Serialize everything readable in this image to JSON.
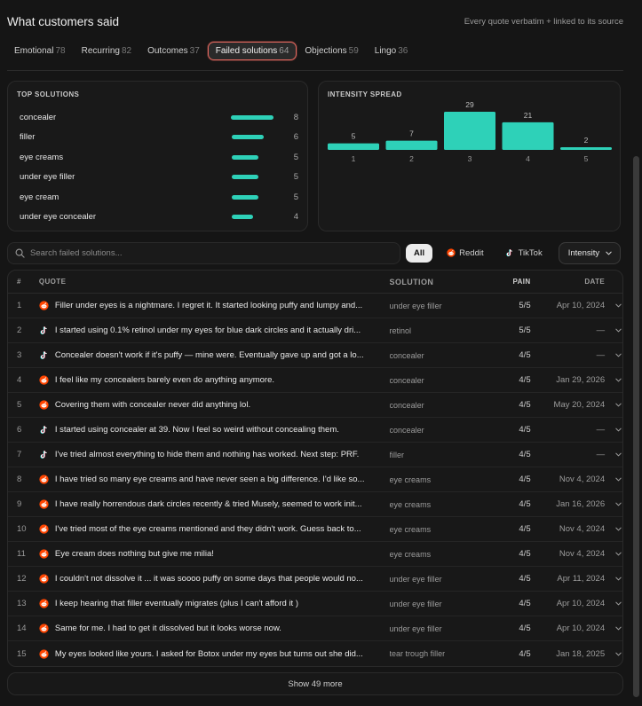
{
  "header": {
    "title": "What customers said",
    "subtitle": "Every quote verbatim + linked to its source"
  },
  "tabs": [
    {
      "label": "Emotional",
      "count": "78"
    },
    {
      "label": "Recurring",
      "count": "82"
    },
    {
      "label": "Outcomes",
      "count": "37"
    },
    {
      "label": "Failed solutions",
      "count": "64",
      "active": true
    },
    {
      "label": "Objections",
      "count": "59"
    },
    {
      "label": "Lingo",
      "count": "36"
    }
  ],
  "top_solutions": {
    "title": "TOP SOLUTIONS",
    "items": [
      {
        "name": "concealer",
        "count": 8
      },
      {
        "name": "filler",
        "count": 6
      },
      {
        "name": "eye creams",
        "count": 5
      },
      {
        "name": "under eye filler",
        "count": 5
      },
      {
        "name": "eye cream",
        "count": 5
      },
      {
        "name": "under eye concealer",
        "count": 4
      }
    ]
  },
  "chart_data": {
    "type": "bar",
    "title": "INTENSITY SPREAD",
    "categories": [
      "1",
      "2",
      "3",
      "4",
      "5"
    ],
    "values": [
      5,
      7,
      29,
      21,
      2
    ],
    "ylim": [
      0,
      29
    ],
    "grid": false,
    "color": "#2ed1b8"
  },
  "filters": {
    "search_placeholder": "Search failed solutions...",
    "chips": [
      {
        "label": "All",
        "active": true,
        "icon": ""
      },
      {
        "label": "Reddit",
        "active": false,
        "icon": "reddit-icon"
      },
      {
        "label": "TikTok",
        "active": false,
        "icon": "tiktok-icon"
      }
    ],
    "sort_label": "Intensity"
  },
  "table": {
    "columns": {
      "num": "#",
      "quote": "QUOTE",
      "solution": "SOLUTION",
      "pain": "PAIN",
      "date": "DATE"
    },
    "rows": [
      {
        "num": "1",
        "source": "reddit",
        "quote": "Filler under eyes is a nightmare. I regret it. It started looking puffy and lumpy and...",
        "solution": "under eye filler",
        "pain": "5/5",
        "date": "Apr 10, 2024"
      },
      {
        "num": "2",
        "source": "tiktok",
        "quote": "I started using 0.1% retinol under my eyes for blue dark circles and it actually dri...",
        "solution": "retinol",
        "pain": "5/5",
        "date": "—"
      },
      {
        "num": "3",
        "source": "tiktok",
        "quote": "Concealer doesn't work if it's puffy — mine were. Eventually gave up and got a lo...",
        "solution": "concealer",
        "pain": "4/5",
        "date": "—"
      },
      {
        "num": "4",
        "source": "reddit",
        "quote": "I feel like my concealers barely even do anything anymore.",
        "solution": "concealer",
        "pain": "4/5",
        "date": "Jan 29, 2026"
      },
      {
        "num": "5",
        "source": "reddit",
        "quote": "Covering them with concealer never did anything lol.",
        "solution": "concealer",
        "pain": "4/5",
        "date": "May 20, 2024"
      },
      {
        "num": "6",
        "source": "tiktok",
        "quote": "I started using concealer at 39. Now I feel so weird without concealing them.",
        "solution": "concealer",
        "pain": "4/5",
        "date": "—"
      },
      {
        "num": "7",
        "source": "tiktok",
        "quote": "I've tried almost everything to hide them and nothing has worked. Next step: PRF.",
        "solution": "filler",
        "pain": "4/5",
        "date": "—"
      },
      {
        "num": "8",
        "source": "reddit",
        "quote": "I have tried so many eye creams and have never seen a big difference. I'd like so...",
        "solution": "eye creams",
        "pain": "4/5",
        "date": "Nov 4, 2024"
      },
      {
        "num": "9",
        "source": "reddit",
        "quote": "I have really horrendous dark circles recently & tried Musely, seemed to work init...",
        "solution": "eye creams",
        "pain": "4/5",
        "date": "Jan 16, 2026"
      },
      {
        "num": "10",
        "source": "reddit",
        "quote": "I've tried most of the eye creams mentioned and they didn't work. Guess back to...",
        "solution": "eye creams",
        "pain": "4/5",
        "date": "Nov 4, 2024"
      },
      {
        "num": "11",
        "source": "reddit",
        "quote": "Eye cream does nothing but give me milia!",
        "solution": "eye creams",
        "pain": "4/5",
        "date": "Nov 4, 2024"
      },
      {
        "num": "12",
        "source": "reddit",
        "quote": "I couldn't not dissolve it ... it was soooo puffy on some days that people would no...",
        "solution": "under eye filler",
        "pain": "4/5",
        "date": "Apr 11, 2024"
      },
      {
        "num": "13",
        "source": "reddit",
        "quote": "I keep hearing that filler eventually migrates (plus I can't afford it )",
        "solution": "under eye filler",
        "pain": "4/5",
        "date": "Apr 10, 2024"
      },
      {
        "num": "14",
        "source": "reddit",
        "quote": "Same for me. I had to get it dissolved but it looks worse now.",
        "solution": "under eye filler",
        "pain": "4/5",
        "date": "Apr 10, 2024"
      },
      {
        "num": "15",
        "source": "reddit",
        "quote": "My eyes looked like yours. I asked for Botox under my eyes but turns out she did...",
        "solution": "tear trough filler",
        "pain": "4/5",
        "date": "Jan 18, 2025"
      }
    ]
  },
  "show_more_label": "Show 49 more",
  "colors": {
    "accent": "#2ed1b8",
    "reddit": "#ff4500",
    "active_tab_border": "#e2685f"
  }
}
